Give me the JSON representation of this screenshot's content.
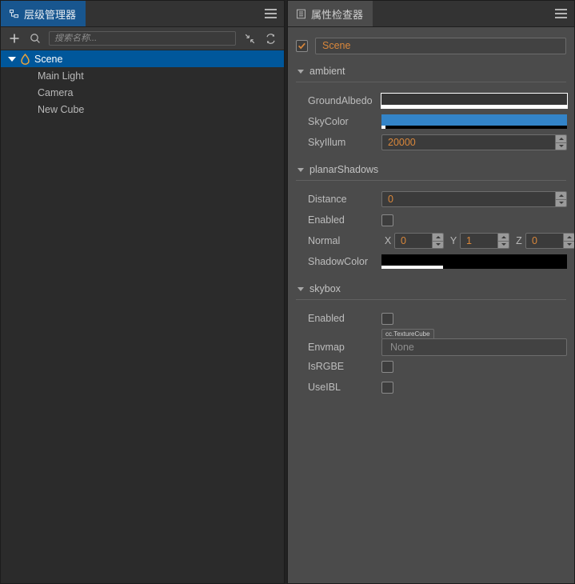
{
  "theme": {
    "accent_orange": "#d9873b",
    "selection_blue": "#00579b",
    "tab_active_blue": "#18568f",
    "panel_left_bg": "#2b2b2b",
    "panel_right_bg": "#4b4b4b"
  },
  "hierarchy": {
    "tab": {
      "label": "层级管理器",
      "icon": "hierarchy-icon"
    },
    "menu_icon": "hamburger-icon",
    "toolbar": {
      "add_icon": "plus-icon",
      "search_icon": "search-icon",
      "collapse_icon": "collapse-all-icon",
      "refresh_icon": "refresh-icon",
      "search_placeholder": "搜索名称...",
      "search_value": ""
    },
    "tree": [
      {
        "label": "Scene",
        "icon": "scene-droplet-icon",
        "expanded": true,
        "selected": true,
        "depth": 0
      },
      {
        "label": "Main Light",
        "icon": "",
        "expanded": false,
        "selected": false,
        "depth": 1
      },
      {
        "label": "Camera",
        "icon": "",
        "expanded": false,
        "selected": false,
        "depth": 1
      },
      {
        "label": "New Cube",
        "icon": "",
        "expanded": false,
        "selected": false,
        "depth": 1
      }
    ]
  },
  "inspector": {
    "tab": {
      "label": "属性检查器",
      "icon": "inspector-icon"
    },
    "menu_icon": "hamburger-icon",
    "node": {
      "enabled": true,
      "name": "Scene"
    },
    "sections": [
      {
        "key": "ambient",
        "title": "ambient",
        "expanded": true,
        "props": [
          {
            "key": "groundalbedo",
            "label": "GroundAlbedo",
            "type": "color",
            "color": "#353535",
            "alpha_pct": 100,
            "outlined": true
          },
          {
            "key": "skycolor",
            "label": "SkyColor",
            "type": "color",
            "color": "#3384c8",
            "alpha_pct": 2,
            "outlined": false
          },
          {
            "key": "skyillum",
            "label": "SkyIllum",
            "type": "number",
            "value": "20000"
          }
        ]
      },
      {
        "key": "planarshadows",
        "title": "planarShadows",
        "expanded": true,
        "props": [
          {
            "key": "distance",
            "label": "Distance",
            "type": "number",
            "value": "0"
          },
          {
            "key": "enabled",
            "label": "Enabled",
            "type": "checkbox",
            "checked": false
          },
          {
            "key": "normal",
            "label": "Normal",
            "type": "vector3",
            "axes": [
              {
                "axis": "X",
                "value": "0"
              },
              {
                "axis": "Y",
                "value": "1"
              },
              {
                "axis": "Z",
                "value": "0"
              }
            ]
          },
          {
            "key": "shadowcolor",
            "label": "ShadowColor",
            "type": "color",
            "color": "#000000",
            "alpha_pct": 33,
            "outlined": false
          }
        ]
      },
      {
        "key": "skybox",
        "title": "skybox",
        "expanded": true,
        "props": [
          {
            "key": "sb-enabled",
            "label": "Enabled",
            "type": "checkbox",
            "checked": false
          },
          {
            "key": "envmap",
            "label": "Envmap",
            "type": "asset",
            "asset_type": "cc.TextureCube",
            "value": "None"
          },
          {
            "key": "isrgbe",
            "label": "IsRGBE",
            "type": "checkbox",
            "checked": false
          },
          {
            "key": "useibl",
            "label": "UseIBL",
            "type": "checkbox",
            "checked": false
          }
        ]
      }
    ]
  }
}
